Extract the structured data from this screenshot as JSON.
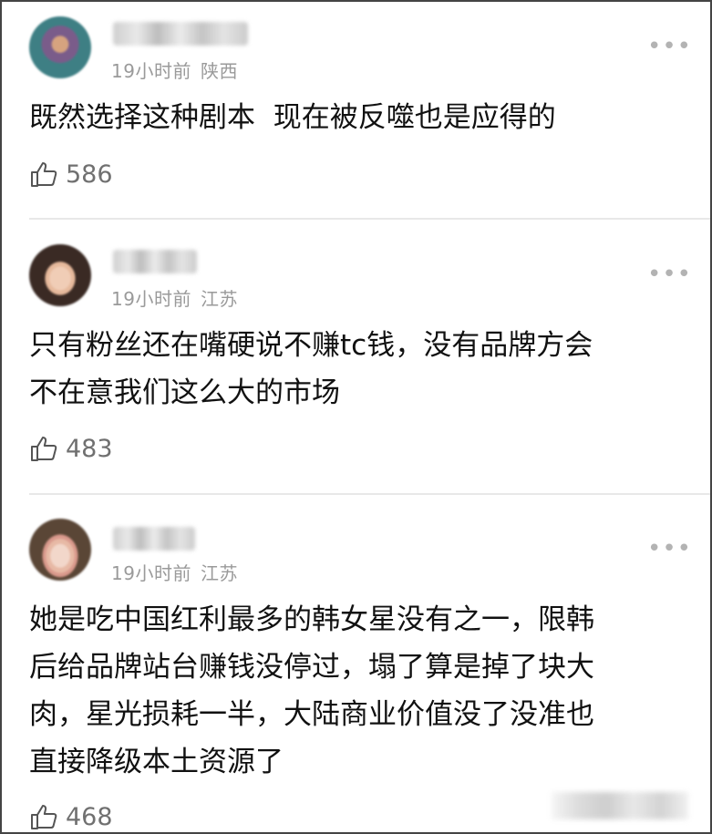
{
  "comments": [
    {
      "time": "19小时前",
      "location": "陕西",
      "text": "既然选择这种剧本  现在被反噬也是应得的",
      "likes": "586",
      "avatar_colors": [
        "#3e7f84",
        "#7a5c8a",
        "#5d6f9a",
        "#d6a37f"
      ]
    },
    {
      "time": "19小时前",
      "location": "江苏",
      "text": "只有粉丝还在嘴硬说不赚tc钱，没有品牌方会\n不在意我们这么大的市场",
      "likes": "483",
      "avatar_colors": [
        "#3a2a24",
        "#e6b99c",
        "#f0cdb6",
        "#5a3a2e"
      ]
    },
    {
      "time": "19小时前",
      "location": "江苏",
      "text": "她是吃中国红利最多的韩女星没有之一，限韩\n后给品牌站台赚钱没停过，塌了算是掉了块大\n肉，星光损耗一半，大陆商业价值没了没准也\n直接降级本土资源了",
      "likes": "468",
      "avatar_colors": [
        "#5a4636",
        "#e7b9a5",
        "#d9998c",
        "#f2d7ca"
      ]
    }
  ],
  "more_label": "•••",
  "icons": {
    "like": "thumbs-up-icon",
    "more": "more-dots-icon"
  },
  "colors": {
    "meta": "#9a9a9a",
    "text": "#111111",
    "divider": "#e8e8e8",
    "frame": "#444444"
  }
}
